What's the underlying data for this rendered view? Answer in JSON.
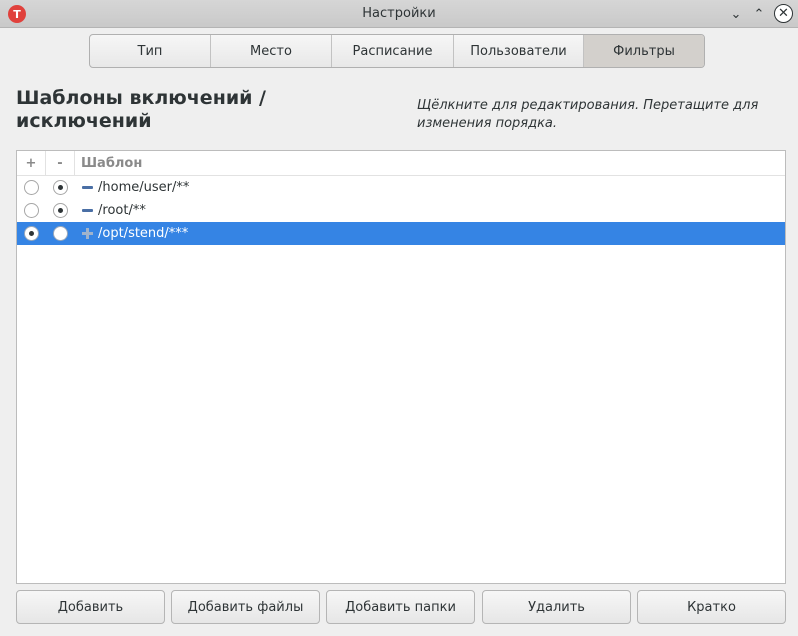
{
  "window": {
    "title": "Настройки",
    "app_icon_glyph": "T",
    "minimize_glyph": "⌄",
    "maximize_glyph": "⌃",
    "close_glyph": "✕"
  },
  "tabs": [
    {
      "label": "Тип",
      "active": false
    },
    {
      "label": "Место",
      "active": false
    },
    {
      "label": "Расписание",
      "active": false
    },
    {
      "label": "Пользователи",
      "active": false
    },
    {
      "label": "Фильтры",
      "active": true
    }
  ],
  "section": {
    "heading": "Шаблоны включений / исключений",
    "hint": "Щёлкните для редактирования. Перетащите для изменения порядка."
  },
  "list": {
    "headers": {
      "plus": "+",
      "minus": "-",
      "pattern": "Шаблон"
    },
    "rows": [
      {
        "include": false,
        "exclude": true,
        "type_icon": "minus-icon",
        "pattern": "/home/user/**",
        "selected": false
      },
      {
        "include": false,
        "exclude": true,
        "type_icon": "minus-icon",
        "pattern": "/root/**",
        "selected": false
      },
      {
        "include": true,
        "exclude": false,
        "type_icon": "plus-icon",
        "pattern": "/opt/stend/***",
        "selected": true
      }
    ]
  },
  "buttons": {
    "add": "Добавить",
    "add_files": "Добавить файлы",
    "add_folders": "Добавить папки",
    "remove": "Удалить",
    "short": "Кратко"
  },
  "colors": {
    "selection": "#3584e4",
    "app_icon": "#e0413c"
  }
}
